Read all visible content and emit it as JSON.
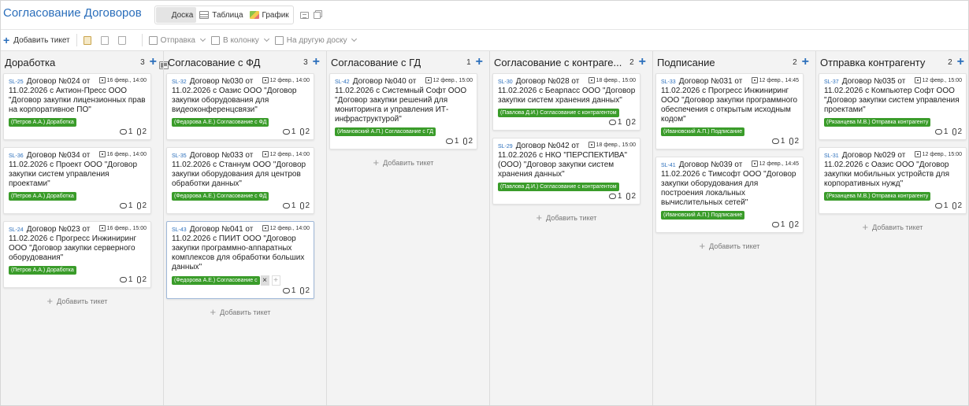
{
  "header": {
    "title": "Согласование Договоров",
    "views": [
      {
        "label": "Доска",
        "icon": "board-icon",
        "active": true
      },
      {
        "label": "Таблица",
        "icon": "table-icon",
        "active": false
      },
      {
        "label": "График",
        "icon": "chart-icon",
        "active": false
      }
    ]
  },
  "toolbar": {
    "add_ticket": "Добавить тикет",
    "send": "Отправка",
    "to_column": "В колонку",
    "to_other_board": "На другую доску"
  },
  "add_ticket_label": "Добавить тикет",
  "columns": [
    {
      "title": "Доработка",
      "count": "3",
      "cards": [
        {
          "id": "SL-25",
          "num": "Договор №024 от",
          "date": "16 февр., 14:00",
          "text": "11.02.2026 с Актион-Пресс ООО \"Договор закупки лицензионных прав на корпоративное ПО\"",
          "tag": "(Петров А.А.) Доработка",
          "comments": "1",
          "files": "2"
        },
        {
          "id": "SL-36",
          "num": "Договор №034 от",
          "date": "16 февр., 14:00",
          "text": "11.02.2026 с Проект ООО \"Договор закупки систем управления проектами\"",
          "tag": "(Петров А.А.) Доработка",
          "comments": "1",
          "files": "2"
        },
        {
          "id": "SL-24",
          "num": "Договор №023 от",
          "date": "16 февр., 15:00",
          "text": "11.02.2026 с Прогресс Инжиниринг ООО \"Договор закупки серверного оборудования\"",
          "tag": "(Петров А.А.) Доработка",
          "comments": "1",
          "files": "2"
        }
      ]
    },
    {
      "title": "Согласование с ФД",
      "count": "3",
      "cards": [
        {
          "id": "SL-32",
          "num": "Договор №030 от",
          "date": "12 февр., 14:00",
          "text": "11.02.2026 с Оазис ООО \"Договор закупки оборудования для видеоконференцсвязи\"",
          "tag": "(Федорова А.Е.) Согласование с ФД",
          "comments": "1",
          "files": "2"
        },
        {
          "id": "SL-35",
          "num": "Договор №033 от",
          "date": "12 февр., 14:00",
          "text": "11.02.2026 с Станнум ООО \"Договор закупки оборудования для центров обработки данных\"",
          "tag": "(Федорова А.Е.) Согласование с ФД",
          "comments": "1",
          "files": "2"
        },
        {
          "id": "SL-43",
          "num": "Договор №041 от",
          "date": "12 февр., 14:00",
          "text": "11.02.2026 с ПИИТ ООО \"Договор закупки программно-аппаратных комплексов для обработки больших данных\"",
          "tag": "(Федорова А.Е.) Согласование с",
          "comments": "1",
          "files": "2",
          "selected": true
        }
      ]
    },
    {
      "title": "Согласование с ГД",
      "count": "1",
      "cards": [
        {
          "id": "SL-42",
          "num": "Договор №040 от",
          "date": "12 февр., 15:00",
          "text": "11.02.2026 с Системный Софт ООО \"Договор закупки решений для мониторинга и управления ИТ-инфраструктурой\"",
          "tag": "(Ивановский А.П.) Согласование с ГД",
          "comments": "1",
          "files": "2"
        }
      ]
    },
    {
      "title": "Согласование с контраге...",
      "count": "2",
      "cards": [
        {
          "id": "SL-30",
          "num": "Договор №028 от",
          "date": "18 февр., 15:00",
          "text": "11.02.2026 с Беарпасс ООО \"Договор закупки систем хранения данных\"",
          "tag": "(Павлова Д.И.) Согласование с контрагентом",
          "comments": "1",
          "files": "2"
        },
        {
          "id": "SL-29",
          "num": "Договор №042 от",
          "date": "18 февр., 15:00",
          "text": "11.02.2026 с НКО \"ПЕРСПЕКТИВА\" (ООО) \"Договор закупки систем хранения данных\"",
          "tag": "(Павлова Д.И.) Согласование с контрагентом",
          "comments": "1",
          "files": "2"
        }
      ]
    },
    {
      "title": "Подписание",
      "count": "2",
      "cards": [
        {
          "id": "SL-33",
          "num": "Договор №031 от",
          "date": "12 февр., 14:45",
          "text": "11.02.2026 с Прогресс Инжиниринг ООО \"Договор закупки программного обеспечения с открытым исходным кодом\"",
          "tag": "(Ивановский А.П.) Подписание",
          "comments": "1",
          "files": "2"
        },
        {
          "id": "SL-41",
          "num": "Договор №039 от",
          "date": "12 февр., 14:45",
          "text": "11.02.2026 с Тимсофт ООО \"Договор закупки оборудования для построения локальных вычислительных сетей\"",
          "tag": "(Ивановский А.П.) Подписание",
          "comments": "1",
          "files": "2"
        }
      ]
    },
    {
      "title": "Отправка контрагенту",
      "count": "2",
      "cards": [
        {
          "id": "SL-37",
          "num": "Договор №035 от",
          "date": "12 февр., 15:00",
          "text": "11.02.2026 с Компьютер Софт ООО \"Договор закупки систем управления проектами\"",
          "tag": "(Рязанцева М.В.) Отправка контрагенту",
          "comments": "1",
          "files": "2"
        },
        {
          "id": "SL-31",
          "num": "Договор №029 от",
          "date": "12 февр., 15:00",
          "text": "11.02.2026 с Оазис ООО \"Договор закупки мобильных устройств для корпоративных нужд\"",
          "tag": "(Рязанцева М.В.) Отправка контрагенту",
          "comments": "1",
          "files": "2"
        }
      ]
    }
  ]
}
